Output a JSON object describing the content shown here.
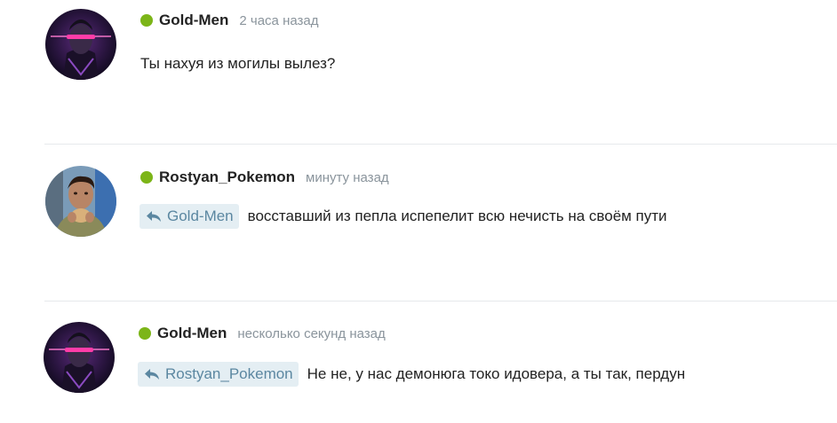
{
  "comments": [
    {
      "username": "Gold-Men",
      "time": "2 часа назад",
      "text": "Ты нахуя из могилы вылез?",
      "reply_to": "",
      "avatar": "gold-men-avatar",
      "online": true
    },
    {
      "username": "Rostyan_Pokemon",
      "time": "минуту назад",
      "text": "восставший из пепла испепелит всю нечисть на своём пути",
      "reply_to": "Gold-Men",
      "avatar": "rostyan-avatar",
      "online": true
    },
    {
      "username": "Gold-Men",
      "time": "несколько секунд назад",
      "text": "Не не, у нас демонюга токо идовера, а ты так, пердун",
      "reply_to": "Rostyan_Pokemon",
      "avatar": "gold-men-avatar",
      "online": true
    }
  ],
  "colors": {
    "online": "#7cb518",
    "reply_bg": "#e4eef3",
    "reply_text": "#5b87a1",
    "muted": "#8a949c"
  }
}
